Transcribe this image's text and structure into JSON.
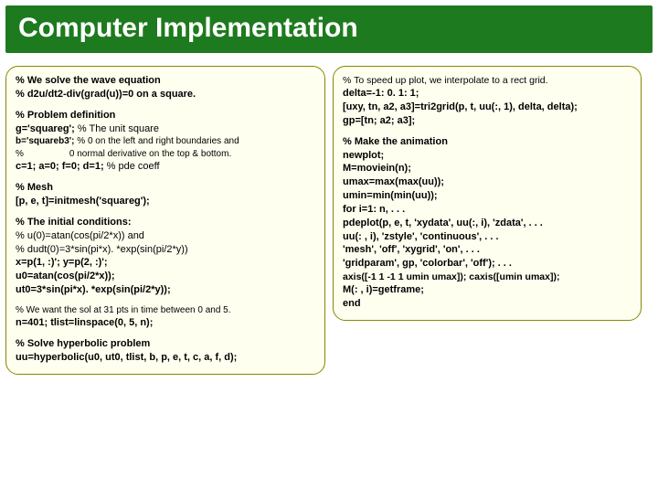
{
  "title": "Computer Implementation",
  "left": {
    "l1": "%       We solve the wave equation",
    "l2": "%        d2u/dt2-div(grad(u))=0   on a square.",
    "l3": "%        Problem definition",
    "l4": "g='squareg'; ",
    "l4b": "% The unit square",
    "l5": "b='squareb3'; ",
    "l5b": "% 0 on the left and right boundaries and",
    "l6a": "%",
    "l6b": "0 normal derivative on the top & bottom.",
    "l7": "c=1;   a=0;  f=0;  d=1;   ",
    "l7b": "% pde coeff",
    "l8": "%        Mesh",
    "l9": "[p, e, t]=initmesh('squareg');",
    "l10": "%        The initial conditions:",
    "l11": "%        u(0)=atan(cos(pi/2*x)) and",
    "l12": "%        dudt(0)=3*sin(pi*x). *exp(sin(pi/2*y))",
    "l13": "x=p(1, :)';   y=p(2, :)';",
    "l14": "u0=atan(cos(pi/2*x));",
    "l15": "ut0=3*sin(pi*x). *exp(sin(pi/2*y));",
    "l16a": "%  ",
    "l16b": "We want the sol at 31 pts in time between 0 and 5.",
    "l17": "n=401;       tlist=linspace(0, 5, n);",
    "l18": "%        Solve hyperbolic problem",
    "l19": "uu=hyperbolic(u0, ut0, tlist, b, p, e, t, c, a, f, d);"
  },
  "right": {
    "r1a": "% ",
    "r1b": "To speed up plot, we interpolate to a rect grid.",
    "r2": "delta=-1: 0. 1: 1;",
    "r3": "[uxy, tn, a2, a3]=tri2grid(p, t, uu(:, 1), delta, delta);",
    "r4": "gp=[tn; a2; a3];",
    "r5": "%        Make the animation",
    "r6": "newplot;",
    "r7": "M=moviein(n);",
    "r8": "umax=max(max(uu));",
    "r9": "umin=min(min(uu));",
    "r10": "for i=1: n, . . .",
    "r11": "  pdeplot(p, e, t, 'xydata', uu(:, i), 'zdata', . . .",
    "r12": "          uu(: , i), 'zstyle', 'continuous', . . .",
    "r13": "          'mesh', 'off', 'xygrid', 'on', . . .",
    "r14": "          'gridparam', gp, 'colorbar', 'off'); . . .",
    "r15": "   axis([-1 1 -1 1 umin umax]); caxis([umin umax]);",
    "r16": "  M(: , i)=getframe;",
    "r17": "  end"
  }
}
